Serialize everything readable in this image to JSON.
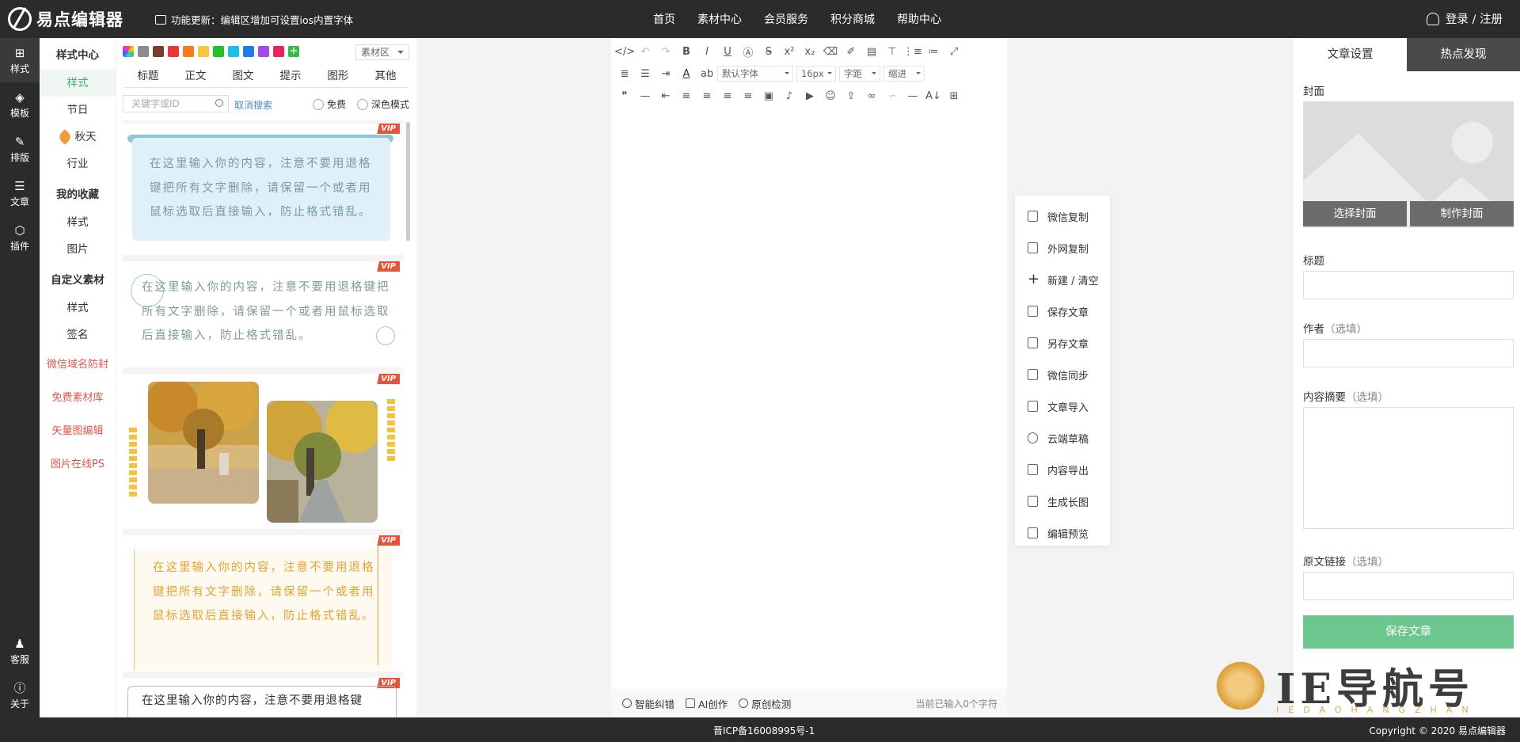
{
  "app": {
    "title": "易点编辑器"
  },
  "topbar": {
    "notice": "功能更新：编辑区增加可设置ios内置字体",
    "nav": [
      "首页",
      "素材中心",
      "会员服务",
      "积分商城",
      "帮助中心"
    ],
    "login": "登录 / 注册"
  },
  "rail": {
    "items": [
      {
        "label": "样式",
        "icon": "grid-icon"
      },
      {
        "label": "模板",
        "icon": "layers-icon"
      },
      {
        "label": "排版",
        "icon": "edit-icon"
      },
      {
        "label": "文章",
        "icon": "article-icon"
      },
      {
        "label": "插件",
        "icon": "plugin-icon"
      }
    ],
    "bottom": [
      {
        "label": "客服",
        "icon": "qq-icon"
      },
      {
        "label": "关于",
        "icon": "info-icon"
      }
    ]
  },
  "sidenav": {
    "style_center": "样式中心",
    "style": "样式",
    "festival": "节日",
    "autumn": "秋天",
    "industry": "行业",
    "favorites": "我的收藏",
    "fav_style": "样式",
    "fav_image": "图片",
    "custom": "自定义素材",
    "custom_style": "样式",
    "custom_sign": "签名",
    "links": [
      "微信域名防封",
      "免费素材库",
      "矢量图编辑",
      "图片在线PS"
    ]
  },
  "material": {
    "swatches": [
      "#ffffff",
      "#8c8c8c",
      "#7a3b30",
      "#e53935",
      "#f57c1f",
      "#f4c842",
      "#22c222",
      "#1fbfe6",
      "#1e7be8",
      "#a44ce6",
      "#e8245a",
      "#3bb64d"
    ],
    "source_select": "素材区",
    "categories": [
      "标题",
      "正文",
      "图文",
      "提示",
      "图形",
      "其他"
    ],
    "search_placeholder": "关键字或ID",
    "cancel_search": "取消搜索",
    "free": "免费",
    "dark": "深色模式",
    "vip": "VIP",
    "sample_text": "在这里输入你的内容，注意不要用退格键把所有文字删除，请保留一个或者用鼠标选取后直接输入，防止格式错乱。",
    "sample_text_short": "在这里输入你的内容，注意不要用退格键"
  },
  "toolbar": {
    "font_select": "默认字体",
    "size_select": "16px",
    "spacing_select": "字距",
    "indent_select": "缩进"
  },
  "editor_footer": {
    "smart_fix": "智能纠错",
    "ai_create": "AI创作",
    "original_check": "原创检测",
    "count": "当前已输入0个字符"
  },
  "actions": [
    "微信复制",
    "外网复制",
    "新建 / 清空",
    "保存文章",
    "另存文章",
    "微信同步",
    "文章导入",
    "云端草稿",
    "内容导出",
    "生成长图",
    "编辑预览"
  ],
  "right": {
    "tabs": [
      "文章设置",
      "热点发现"
    ],
    "cover_label": "封面",
    "choose_cover": "选择封面",
    "make_cover": "制作封面",
    "title_label": "标题",
    "author_label": "作者",
    "abstract_label": "内容摘要",
    "source_label": "原文链接",
    "optional": "（选填）",
    "save": "保存文章"
  },
  "footer": {
    "icp": "晋ICP备16008995号-1",
    "copyright": "Copyright © 2020 易点编辑器"
  },
  "watermark": {
    "text": "IE导航号",
    "sub": "IEDAOHANGZHAN"
  }
}
